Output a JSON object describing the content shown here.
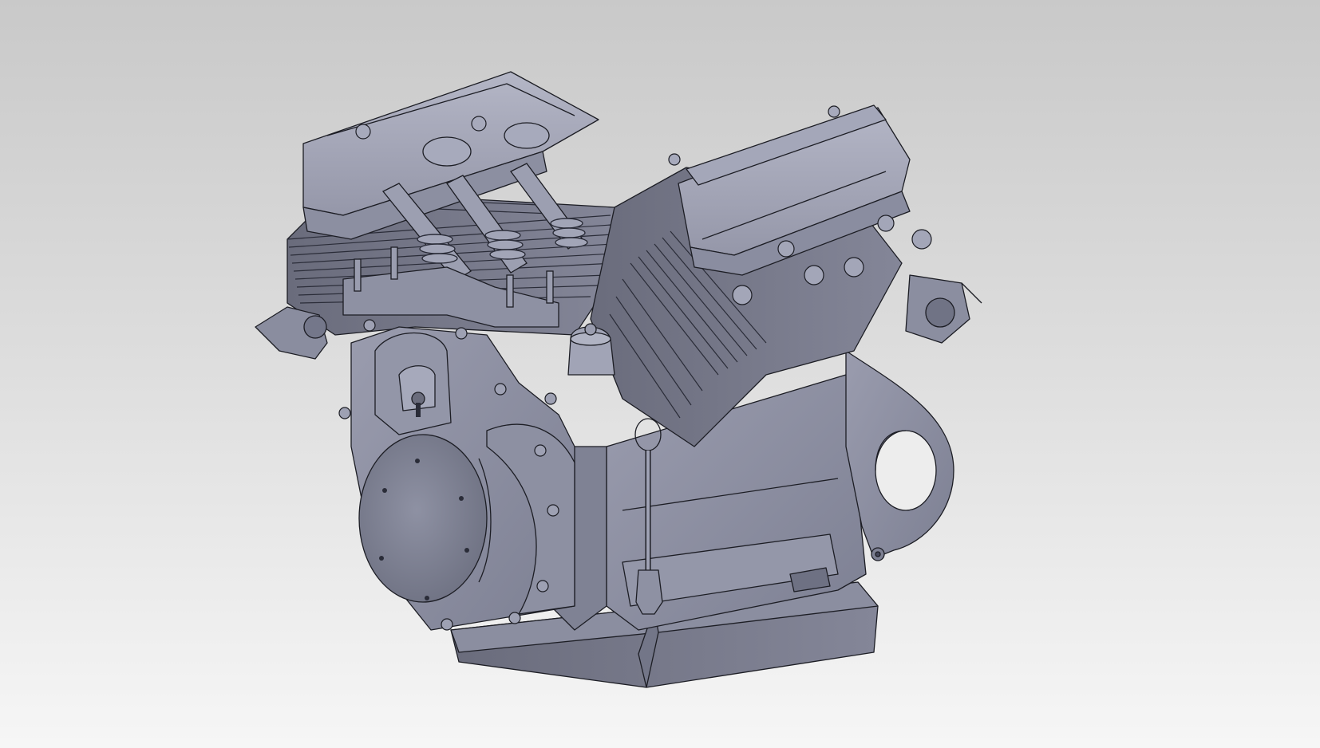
{
  "viewport": {
    "background_top": "#c9c9c9",
    "background_bottom": "#f6f6f6"
  },
  "model": {
    "icon": "v-twin-engine-cad-model",
    "body_color": "#8a8d9f",
    "shadow_color": "#6a6c7c",
    "highlight_color": "#a9abbb",
    "edge_color": "#1c1d24"
  }
}
